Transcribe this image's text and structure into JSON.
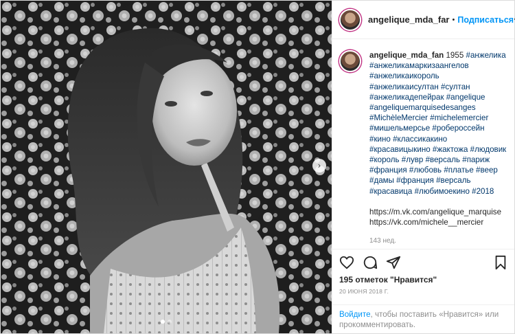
{
  "header": {
    "username": "angelique_mda_far",
    "separator": "•",
    "follow_label": "Подписаться",
    "more_label": "···"
  },
  "caption": {
    "username": "angelique_mda_fan",
    "year": "1955",
    "hashtags": "#анжелика #анжеликамаркизаангелов #анжеликаикороль #анжеликаисултан #султан #анжеликадепейрак #angelique #angeliquemarquisedesanges #MichèleMercier #michelemercier #мишельмерсье #робероссейн #кино #классикакино #красавицыкино #жактожа #людовик #король #лувр #версаль #париж #франция #любовь #платье #веер #дамы #франция #версаль #красавица #любимоекино #2018",
    "link1": "https://m.vk.com/angelique_marquise",
    "link2": "https://vk.com/michele__mercier",
    "time": "143 нед."
  },
  "actions": {
    "like_icon": "heart-icon",
    "comment_icon": "comment-icon",
    "share_icon": "share-icon",
    "save_icon": "bookmark-icon"
  },
  "likes": "195 отметок \"Нравится\"",
  "date": "20 июня 2018 г.",
  "login": {
    "link_label": "Войдите",
    "rest": ", чтобы поставить «Нравится» или прокомментировать."
  },
  "photo": {
    "next_icon": "chevron-right-icon"
  }
}
